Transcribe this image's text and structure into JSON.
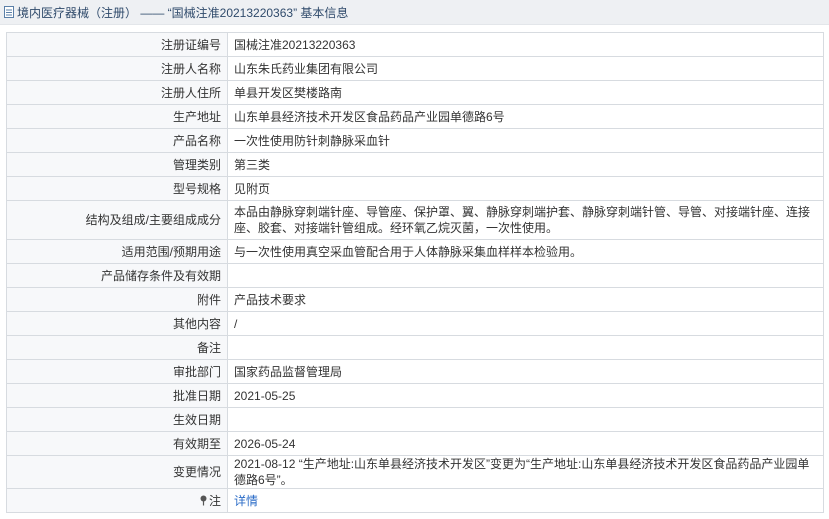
{
  "header": {
    "title": "境内医疗器械（注册） —— “国械注准20213220363” 基本信息"
  },
  "rows": [
    {
      "label": "注册证编号",
      "value": "国械注准20213220363"
    },
    {
      "label": "注册人名称",
      "value": "山东朱氏药业集团有限公司"
    },
    {
      "label": "注册人住所",
      "value": "单县开发区樊楼路南"
    },
    {
      "label": "生产地址",
      "value": "山东单县经济技术开发区食品药品产业园单德路6号"
    },
    {
      "label": "产品名称",
      "value": "一次性使用防针刺静脉采血针"
    },
    {
      "label": "管理类别",
      "value": "第三类"
    },
    {
      "label": "型号规格",
      "value": "见附页"
    },
    {
      "label": "结构及组成/主要组成成分",
      "value": "本品由静脉穿刺端针座、导管座、保护罩、翼、静脉穿刺端护套、静脉穿刺端针管、导管、对接端针座、连接座、胶套、对接端针管组成。经环氧乙烷灭菌，一次性使用。"
    },
    {
      "label": "适用范围/预期用途",
      "value": "与一次性使用真空采血管配合用于人体静脉采集血样样本检验用。"
    },
    {
      "label": "产品储存条件及有效期",
      "value": ""
    },
    {
      "label": "附件",
      "value": "产品技术要求"
    },
    {
      "label": "其他内容",
      "value": "/"
    },
    {
      "label": "备注",
      "value": ""
    },
    {
      "label": "审批部门",
      "value": "国家药品监督管理局"
    },
    {
      "label": "批准日期",
      "value": "2021-05-25"
    },
    {
      "label": "生效日期",
      "value": ""
    },
    {
      "label": "有效期至",
      "value": "2026-05-24"
    },
    {
      "label": "变更情况",
      "value": "2021-08-12 “生产地址:山东单县经济技术开发区”变更为“生产地址:山东单县经济技术开发区食品药品产业园单德路6号”。"
    }
  ],
  "note_row": {
    "label": "注",
    "link": "详情",
    "icon": "pin-icon"
  },
  "colors": {
    "header_bg": "#eef0f3",
    "label_bg": "#f7f8fa",
    "border": "#d7dbe0",
    "link": "#2a6bc7"
  }
}
